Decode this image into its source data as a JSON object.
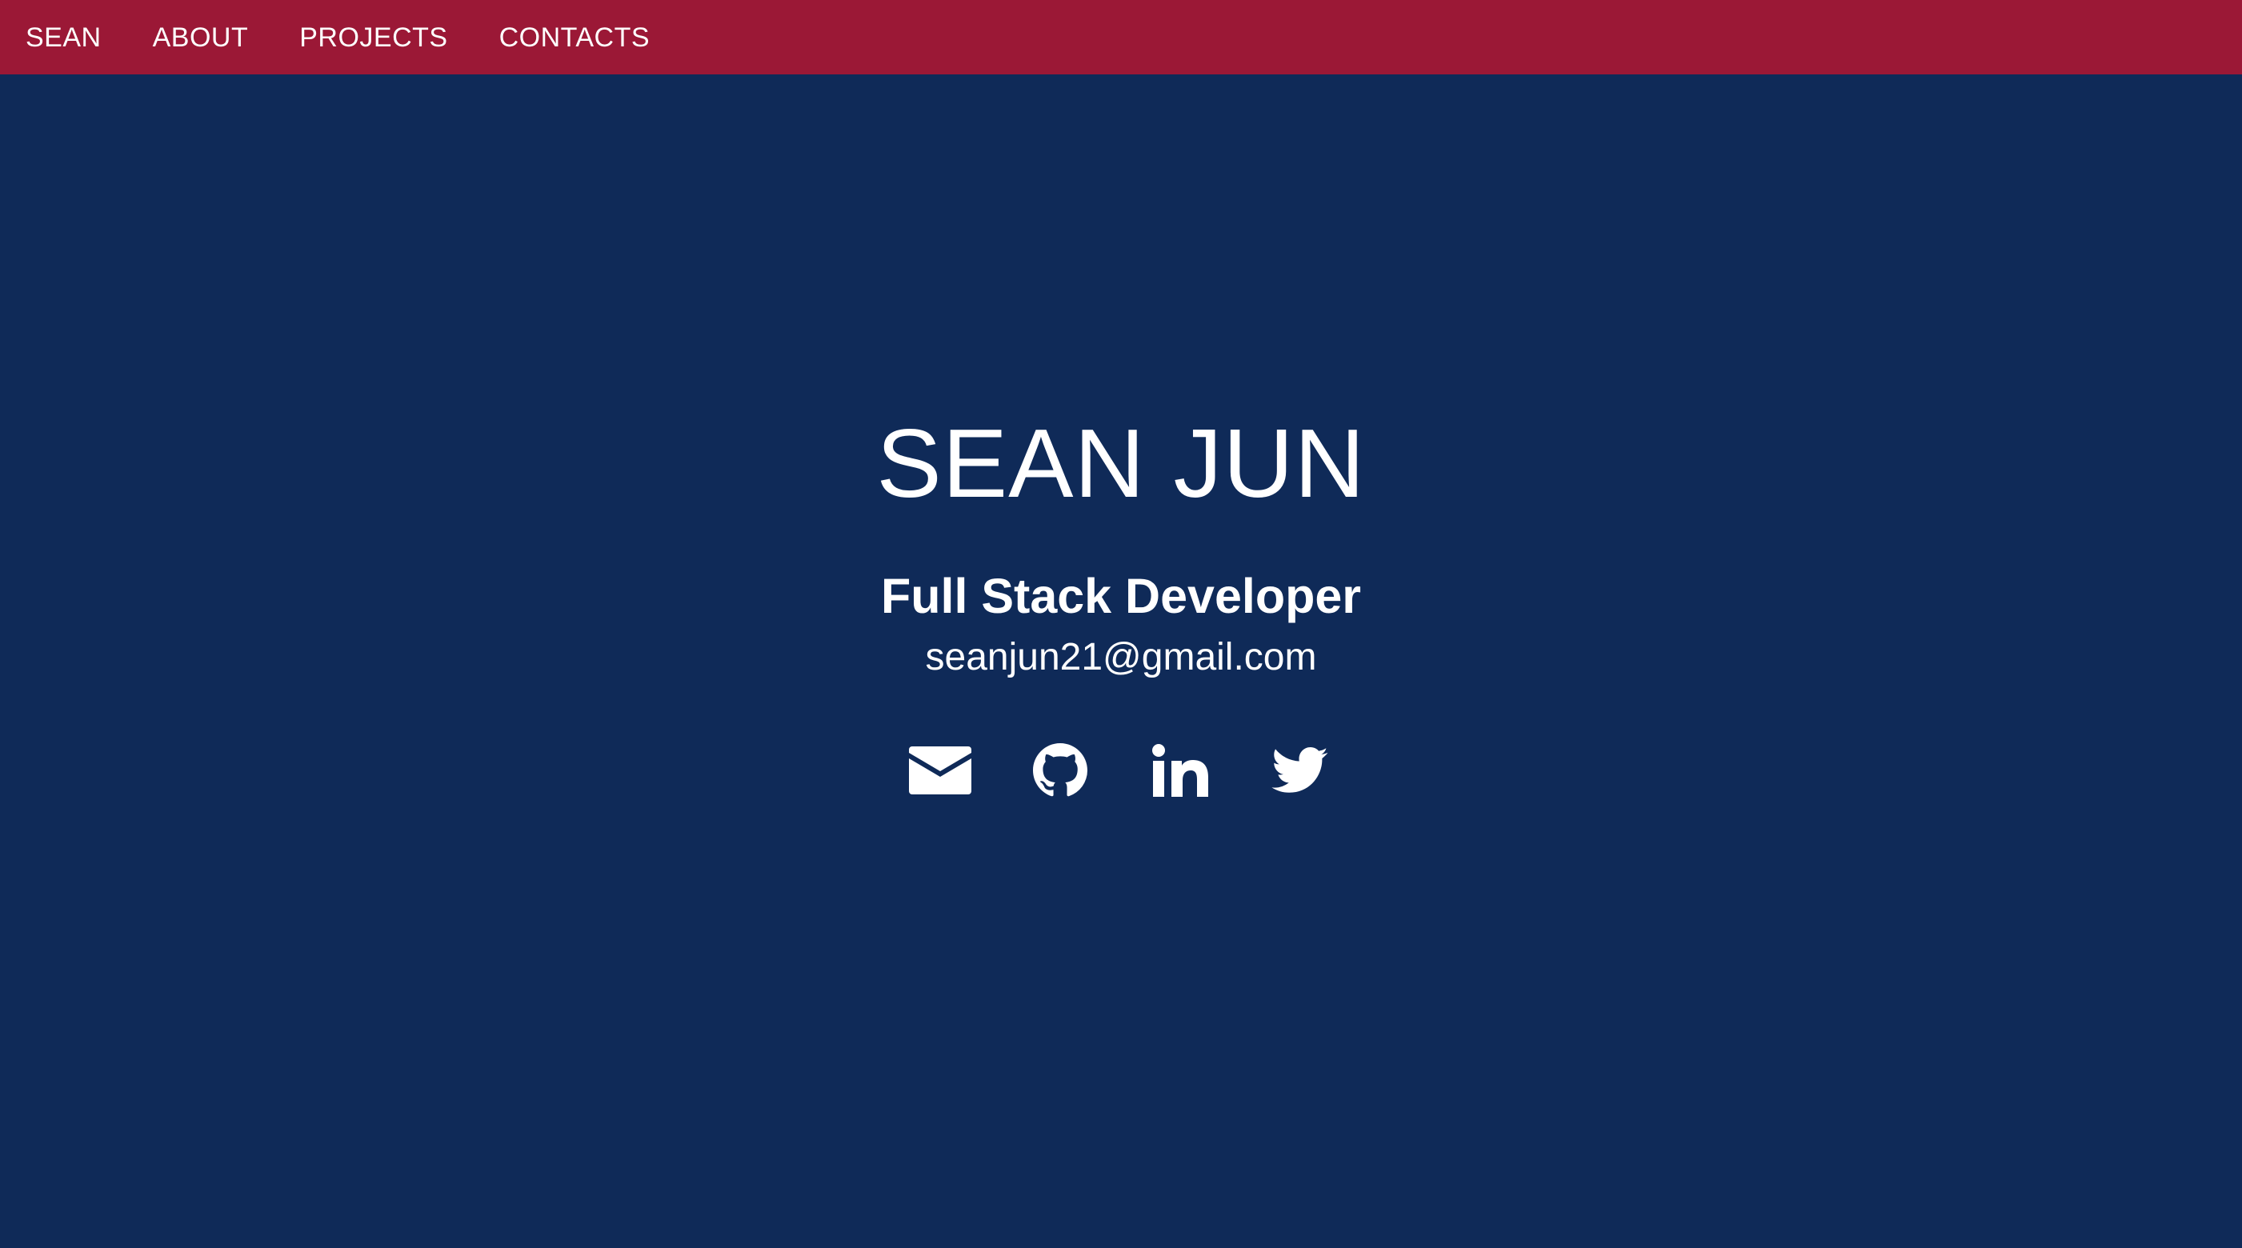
{
  "nav": {
    "brand": "SEAN",
    "links": [
      "ABOUT",
      "PROJECTS",
      "CONTACTS"
    ]
  },
  "hero": {
    "name": "SEAN JUN",
    "role": "Full Stack Developer",
    "email": "seanjun21@gmail.com"
  },
  "social": [
    {
      "icon": "envelope-icon"
    },
    {
      "icon": "github-icon"
    },
    {
      "icon": "linkedin-icon"
    },
    {
      "icon": "twitter-icon"
    }
  ],
  "colors": {
    "navbar": "#9b1836",
    "background": "#0f2a58",
    "text": "#ffffff"
  }
}
